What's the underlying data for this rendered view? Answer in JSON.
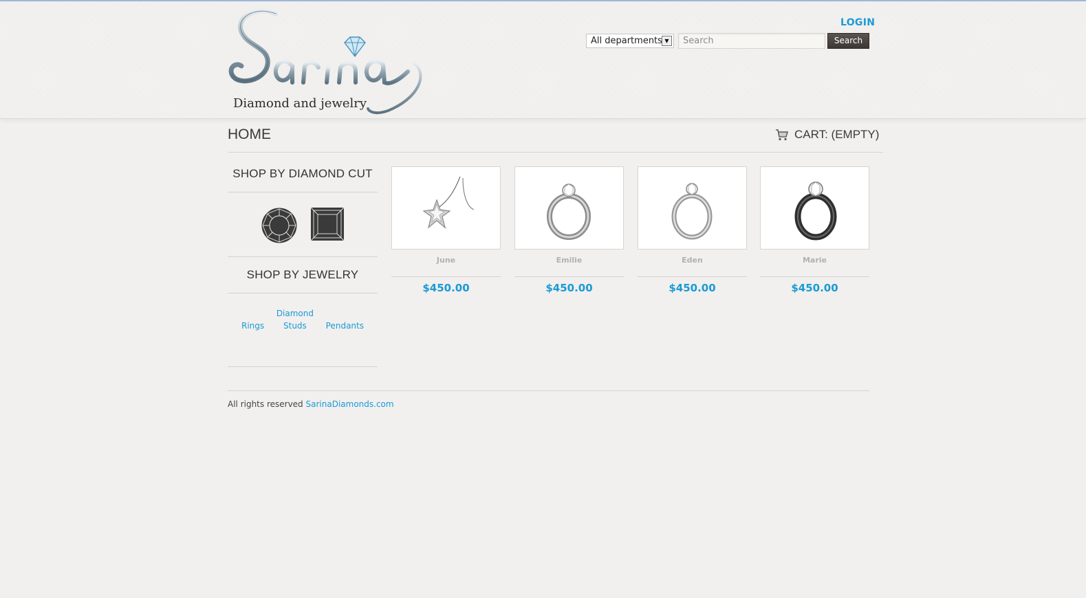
{
  "brand": {
    "logo_text": "Sarina",
    "tagline": "Diamond and jewelry"
  },
  "header": {
    "login_label": "LOGIN",
    "department_selected": "All departments",
    "search_placeholder": "Search",
    "search_button_label": "Search"
  },
  "page": {
    "title": "HOME",
    "cart_label": "CART: (EMPTY)"
  },
  "sidebar": {
    "diamond_cut_heading": "SHOP BY DIAMOND CUT",
    "cuts": [
      {
        "name": "round-cut-icon"
      },
      {
        "name": "princess-cut-icon"
      }
    ],
    "jewelry_heading": "SHOP BY JEWELRY",
    "jewelry_links": [
      {
        "label": "Rings"
      },
      {
        "label_line1": "Diamond",
        "label_line2": "Studs"
      },
      {
        "label": "Pendants"
      }
    ]
  },
  "products": [
    {
      "name": "June",
      "price": "$450.00",
      "icon": "star-pendant-icon"
    },
    {
      "name": "Emilie",
      "price": "$450.00",
      "icon": "ring-icon"
    },
    {
      "name": "Eden",
      "price": "$450.00",
      "icon": "ring-icon"
    },
    {
      "name": "Marie",
      "price": "$450.00",
      "icon": "ring-icon"
    }
  ],
  "footer": {
    "text": "All rights reserved",
    "link": "SarinaDiamonds.com"
  },
  "colors": {
    "accent": "#1a9ad6",
    "background": "#f1f0ee",
    "button_dark": "#46423e"
  }
}
